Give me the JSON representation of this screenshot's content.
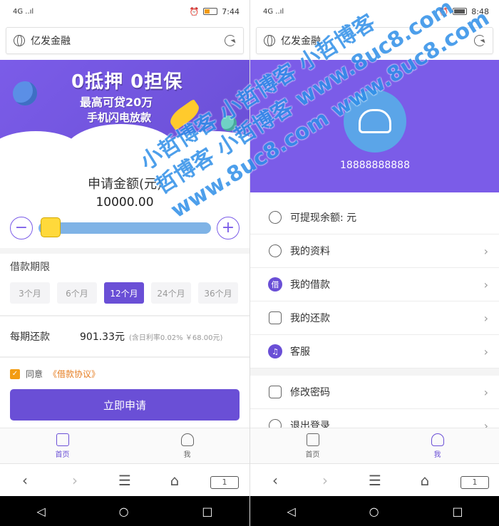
{
  "left": {
    "status": {
      "signal": "4G ..ıl",
      "time": "7:44"
    },
    "url_title": "亿发金融",
    "banner": {
      "line1": "0抵押  0担保",
      "line2": "最高可贷20万",
      "line3": "手机闪电放款"
    },
    "amount_label": "申请金额(元)",
    "amount_value": "10000.00",
    "minus": "−",
    "plus": "+",
    "slider_level": 0.02,
    "term_label": "借款期限",
    "terms": [
      "3个月",
      "6个月",
      "12个月",
      "24个月",
      "36个月"
    ],
    "active_term": "12个月",
    "repay_label": "每期还款",
    "repay_amount": "901.33元",
    "repay_note": "(含日利率0.02% ￥68.00元)",
    "agree_prefix": "同意",
    "agree_link": "《借款协议》",
    "apply_button": "立即申请",
    "tabs": [
      {
        "label": "首页"
      },
      {
        "label": "我"
      }
    ],
    "tab_count": "1"
  },
  "right": {
    "status": {
      "signal": "4G ..ıl",
      "time": "8:48"
    },
    "url_title": "亿发金融",
    "phone_number": "18888888888",
    "menu": [
      {
        "label": "可提现余额: 元"
      },
      {
        "label": "我的资料"
      },
      {
        "label": "我的借款"
      },
      {
        "label": "我的还款"
      },
      {
        "label": "客服"
      },
      {
        "label": "修改密码"
      },
      {
        "label": "退出登录"
      }
    ],
    "tabs": [
      {
        "label": "首页"
      },
      {
        "label": "我"
      }
    ],
    "tab_count": "1"
  },
  "watermark": [
    "小哲博客 小哲博客 小哲博客",
    "哲博客 小哲博客 www.8uc8.com",
    "www.8uc8.com www.8uc8.com"
  ],
  "colors": {
    "primary": "#6a4fd6",
    "accent": "#f39c12",
    "watermark": "#2f8fe8"
  }
}
